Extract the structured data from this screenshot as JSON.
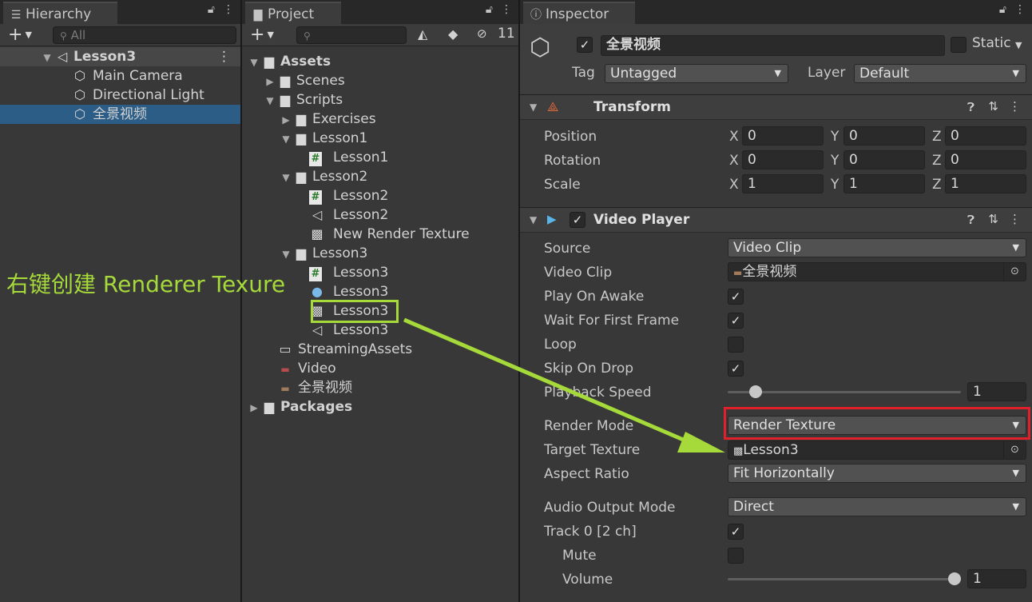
{
  "hierarchy": {
    "tab_label": "Hierarchy",
    "search_placeholder": "All",
    "scene_name": "Lesson3",
    "items": [
      "Main Camera",
      "Directional Light",
      "全景视频"
    ]
  },
  "project": {
    "tab_label": "Project",
    "hidden_count": "11",
    "tree": [
      {
        "label": "Assets",
        "bold": true
      },
      {
        "label": "Scenes"
      },
      {
        "label": "Scripts"
      },
      {
        "label": "Exercises"
      },
      {
        "label": "Lesson1"
      },
      {
        "label": "Lesson1"
      },
      {
        "label": "Lesson2"
      },
      {
        "label": "Lesson2"
      },
      {
        "label": "Lesson2"
      },
      {
        "label": "New Render Texture"
      },
      {
        "label": "Lesson3"
      },
      {
        "label": "Lesson3"
      },
      {
        "label": "Lesson3"
      },
      {
        "label": "Lesson3"
      },
      {
        "label": "Lesson3"
      },
      {
        "label": "StreamingAssets"
      },
      {
        "label": "Video"
      },
      {
        "label": "全景视频"
      },
      {
        "label": "Packages",
        "bold": true
      }
    ]
  },
  "annotation": {
    "text": "右键创建 Renderer Texure",
    "color": "#a6d93a",
    "highlight_red": "#e0202a"
  },
  "inspector": {
    "tab_label": "Inspector",
    "object_name": "全景视频",
    "static_label": "Static",
    "tag_label": "Tag",
    "tag_value": "Untagged",
    "layer_label": "Layer",
    "layer_value": "Default",
    "transform": {
      "title": "Transform",
      "rows": [
        {
          "label": "Position",
          "x": "0",
          "y": "0",
          "z": "0"
        },
        {
          "label": "Rotation",
          "x": "0",
          "y": "0",
          "z": "0"
        },
        {
          "label": "Scale",
          "x": "1",
          "y": "1",
          "z": "1"
        }
      ],
      "axis_x": "X",
      "axis_y": "Y",
      "axis_z": "Z"
    },
    "video_player": {
      "title": "Video Player",
      "source_label": "Source",
      "source_value": "Video Clip",
      "clip_label": "Video Clip",
      "clip_value": "全景视频",
      "play_on_awake_label": "Play On Awake",
      "wait_label": "Wait For First Frame",
      "loop_label": "Loop",
      "skip_label": "Skip On Drop",
      "speed_label": "Playback Speed",
      "speed_value": "1",
      "render_mode_label": "Render Mode",
      "render_mode_value": "Render Texture",
      "target_label": "Target Texture",
      "target_value": "Lesson3",
      "aspect_label": "Aspect Ratio",
      "aspect_value": "Fit Horizontally",
      "audio_label": "Audio Output Mode",
      "audio_value": "Direct",
      "track_label": "Track 0 [2 ch]",
      "mute_label": "Mute",
      "volume_label": "Volume",
      "volume_value": "1"
    }
  }
}
